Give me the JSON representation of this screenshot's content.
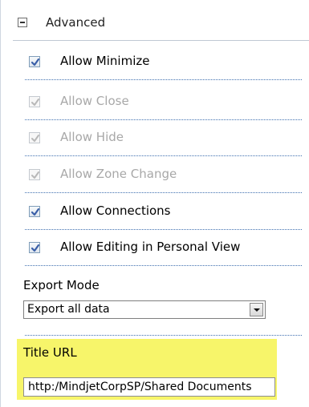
{
  "section": {
    "title": "Advanced",
    "collapse_icon": "minus-box-icon"
  },
  "options": [
    {
      "label": "Allow Minimize",
      "checked": true,
      "enabled": true
    },
    {
      "label": "Allow Close",
      "checked": true,
      "enabled": false
    },
    {
      "label": "Allow Hide",
      "checked": true,
      "enabled": false
    },
    {
      "label": "Allow Zone Change",
      "checked": true,
      "enabled": false
    },
    {
      "label": "Allow Connections",
      "checked": true,
      "enabled": true
    },
    {
      "label": "Allow Editing in Personal View",
      "checked": true,
      "enabled": true
    }
  ],
  "export_mode": {
    "label": "Export Mode",
    "selected": "Export all data"
  },
  "title_url": {
    "label": "Title URL",
    "value": "http:/MindjetCorpSP/Shared Documents"
  },
  "colors": {
    "check_active": "#3a5fa8",
    "check_disabled": "#b8b8b8",
    "highlight": "#f7f56a",
    "dotted_rule": "#3f6fb0"
  }
}
